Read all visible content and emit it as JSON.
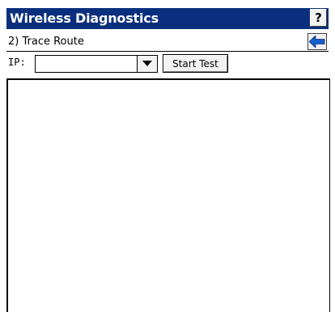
{
  "window": {
    "title": "Wireless Diagnostics",
    "help_label": "?"
  },
  "subheader": {
    "title": "2) Trace Route",
    "back_icon": "arrow-left-icon"
  },
  "form": {
    "ip_label": "IP:",
    "ip_value": "",
    "dropdown_icon": "chevron-down-icon",
    "start_label": "Start Test"
  },
  "output": {
    "text": ""
  },
  "colors": {
    "titlebar": "#0a2f7c",
    "arrow": "#1560c8"
  }
}
